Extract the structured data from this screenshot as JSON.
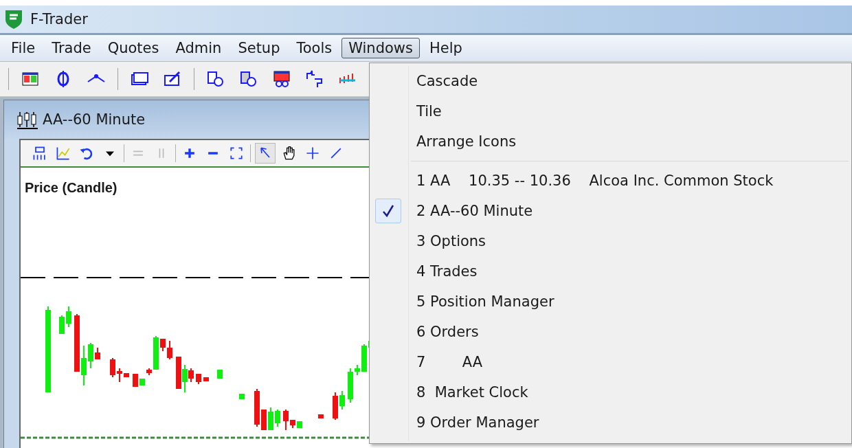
{
  "window": {
    "title": "F-Trader"
  },
  "menu_bar": [
    {
      "label": "File",
      "selected": false
    },
    {
      "label": "Trade",
      "selected": false
    },
    {
      "label": "Quotes",
      "selected": false
    },
    {
      "label": "Admin",
      "selected": false
    },
    {
      "label": "Setup",
      "selected": false
    },
    {
      "label": "Tools",
      "selected": false
    },
    {
      "label": "Windows",
      "selected": true
    },
    {
      "label": "Help",
      "selected": false
    }
  ],
  "child_window": {
    "title": "AA--60 Minute",
    "chart_title": "Price (Candle)"
  },
  "windows_menu": {
    "commands": [
      "Cascade",
      "Tile",
      "Arrange Icons"
    ],
    "windows": [
      {
        "label": "1 AA    10.35 -- 10.36    Alcoa Inc. Common Stock",
        "checked": false
      },
      {
        "label": "2 AA--60 Minute",
        "checked": true
      },
      {
        "label": "3 Options",
        "checked": false
      },
      {
        "label": "4 Trades",
        "checked": false
      },
      {
        "label": "5 Position Manager",
        "checked": false
      },
      {
        "label": "6 Orders",
        "checked": false
      },
      {
        "label": "7        AA",
        "checked": false
      },
      {
        "label": "8  Market Clock",
        "checked": false
      },
      {
        "label": "9 Order Manager",
        "checked": false
      }
    ]
  }
}
